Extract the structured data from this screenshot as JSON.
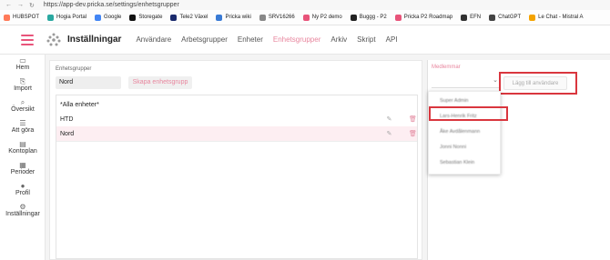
{
  "browser": {
    "url": "https://app-dev.pricka.se/settings/enhetsgrupper",
    "bookmarks": [
      {
        "label": "HUBSPOT",
        "color": "#ff7a59"
      },
      {
        "label": "Hogia Portal",
        "color": "#2aa8a0"
      },
      {
        "label": "Google",
        "color": "#4285f4"
      },
      {
        "label": "Storegate",
        "color": "#111111"
      },
      {
        "label": "Tele2 Växel",
        "color": "#1a2a6c"
      },
      {
        "label": "Pricka wiki",
        "color": "#3a7bd5"
      },
      {
        "label": "SRV16266",
        "color": "#888888"
      },
      {
        "label": "Ny P2 demo",
        "color": "#e8547a"
      },
      {
        "label": "Buggg - P2",
        "color": "#222222"
      },
      {
        "label": "Pricka P2 Roadmap",
        "color": "#e8547a"
      },
      {
        "label": "EFN",
        "color": "#333333"
      },
      {
        "label": "ChatGPT",
        "color": "#444444"
      },
      {
        "label": "Le Chat - Mistral A",
        "color": "#f4a300"
      }
    ]
  },
  "app": {
    "title": "Inställningar",
    "brand_color": "#e8547a",
    "nav_tabs": [
      {
        "label": "Användare",
        "active": false
      },
      {
        "label": "Arbetsgrupper",
        "active": false
      },
      {
        "label": "Enheter",
        "active": false
      },
      {
        "label": "Enhetsgrupper",
        "active": true
      },
      {
        "label": "Arkiv",
        "active": false
      },
      {
        "label": "Skript",
        "active": false
      },
      {
        "label": "API",
        "active": false
      }
    ]
  },
  "sidebar": {
    "items": [
      {
        "label": "Hem",
        "icon": "▭"
      },
      {
        "label": "Import",
        "icon": "⎘"
      },
      {
        "label": "Översikt",
        "icon": "⌕"
      },
      {
        "label": "Att göra",
        "icon": "☰"
      },
      {
        "label": "Kontoplan",
        "icon": "▤"
      },
      {
        "label": "Perioder",
        "icon": "▦"
      },
      {
        "label": "Profil",
        "icon": "●"
      },
      {
        "label": "Inställningar",
        "icon": "⚙"
      }
    ]
  },
  "groups": {
    "label": "Enhetsgrupper",
    "selected": "Nord",
    "create_button": "Skapa enhetsgrupp",
    "rows": [
      {
        "label": "*Alla enheter*"
      },
      {
        "label": "HTD"
      },
      {
        "label": "Nord"
      }
    ]
  },
  "members": {
    "label": "Medlemmar",
    "add_button": "Lägg till användare",
    "dropdown_items": [
      "Super Admin",
      "Lars-Henrik Fritz",
      "Åke Avdålenmann",
      "Jonni Nonni",
      "Sebastian Klein"
    ]
  },
  "icons": {
    "edit": "✎",
    "delete": "🗑",
    "chevron": "⌄"
  }
}
